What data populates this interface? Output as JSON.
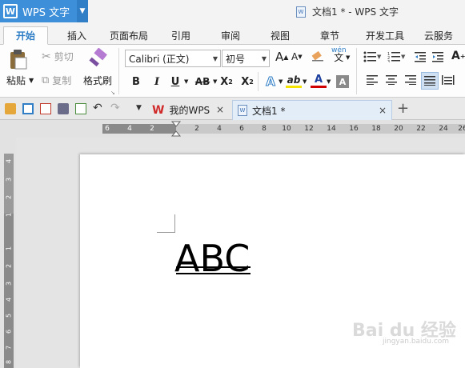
{
  "app": {
    "logo_letter": "W",
    "name": "WPS 文字",
    "window_title": "文档1 * - WPS 文字"
  },
  "menu": {
    "tabs": [
      "开始",
      "插入",
      "页面布局",
      "引用",
      "审阅",
      "视图",
      "章节",
      "开发工具",
      "云服务"
    ]
  },
  "ribbon": {
    "paste": "粘贴",
    "cut": "剪切",
    "copy": "复制",
    "format_painter": "格式刷",
    "font_name": "Calibri (正文)",
    "font_size": "初号",
    "grow_font": "A",
    "shrink_font": "A",
    "bold": "B",
    "italic": "I",
    "underline": "U",
    "strikethrough": "AB",
    "superscript": "X",
    "subscript": "X",
    "text_effect": "A",
    "highlight": "ab",
    "font_color": "A",
    "char_shading": "A",
    "phonetic": "wén",
    "accent_color": "#2f7ec6"
  },
  "doc_tabs": {
    "my_wps": "我的WPS",
    "doc1": "文档1 *"
  },
  "ruler": {
    "h_numbers": [
      "6",
      "4",
      "2",
      "2",
      "4",
      "6",
      "8",
      "10",
      "12",
      "14",
      "16",
      "18",
      "20",
      "22",
      "24",
      "26"
    ],
    "v_numbers": [
      "4",
      "3",
      "2",
      "1",
      "1",
      "2",
      "3",
      "4",
      "5",
      "6",
      "7",
      "8"
    ]
  },
  "document": {
    "text": "ABC"
  },
  "watermark": {
    "text": "Bai du 经验",
    "sub": "jingyan.baidu.com"
  }
}
